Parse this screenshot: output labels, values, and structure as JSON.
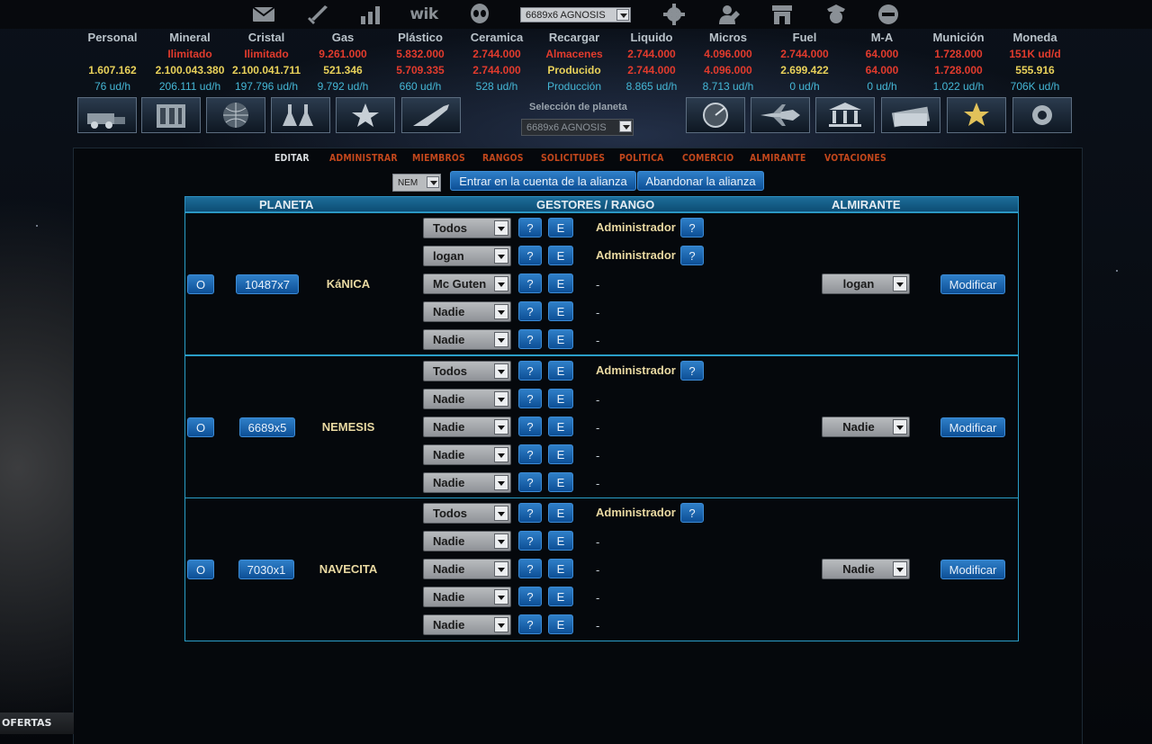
{
  "header": {
    "planet_select": "6689x6 AGNOSIS",
    "planet_select_title": "Selección de planeta",
    "planet_select2": "6689x6 AGNOSIS",
    "wiki_label": "wik"
  },
  "resources": [
    {
      "name": "Personal",
      "line1": "",
      "line2": "1.607.162",
      "line3": "76 ud/h"
    },
    {
      "name": "Mineral",
      "line1": "Ilimitado",
      "line2": "2.100.043.380",
      "line3": "206.111 ud/h"
    },
    {
      "name": "Cristal",
      "line1": "Ilimitado",
      "line2": "2.100.041.711",
      "line3": "197.796 ud/h"
    },
    {
      "name": "Gas",
      "line1": "9.261.000",
      "line2": "521.346",
      "line3": "9.792 ud/h"
    },
    {
      "name": "Plástico",
      "line1": "5.832.000",
      "line2": "5.709.335",
      "line3": "660 ud/h"
    },
    {
      "name": "Ceramica",
      "line1": "2.744.000",
      "line2": "2.744.000",
      "line3": "528 ud/h"
    },
    {
      "name": "Recargar",
      "line1": "Almacenes",
      "line2": "Producido",
      "line3": "Producción"
    },
    {
      "name": "Liquido",
      "line1": "2.744.000",
      "line2": "2.744.000",
      "line3": "8.865 ud/h"
    },
    {
      "name": "Micros",
      "line1": "4.096.000",
      "line2": "4.096.000",
      "line3": "8.713 ud/h"
    },
    {
      "name": "Fuel",
      "line1": "2.744.000",
      "line2": "2.699.422",
      "line3": "0 ud/h"
    },
    {
      "name": "M-A",
      "line1": "64.000",
      "line2": "64.000",
      "line3": "0 ud/h"
    },
    {
      "name": "Munición",
      "line1": "1.728.000",
      "line2": "1.728.000",
      "line3": "1.022 ud/h"
    },
    {
      "name": "Moneda",
      "line1": "151K ud/d",
      "line2": "555.916",
      "line3": "706K ud/h"
    }
  ],
  "tabs": [
    "EDITAR",
    "ADMINISTRAR",
    "MIEMBROS",
    "RANGOS",
    "SOLICITUDES",
    "POLITICA",
    "COMERCIO",
    "ALMIRANTE",
    "VOTACIONES"
  ],
  "actions": {
    "nem_select": "NEM",
    "enter_label": "Entrar en la cuenta de la alianza",
    "leave_label": "Abandonar la alianza"
  },
  "table": {
    "col_planeta": "PLANETA",
    "col_gestores": "GESTORES / RANGO",
    "col_almirante": "ALMIRANTE",
    "o_label": "O",
    "q_label": "?",
    "e_label": "E",
    "modify_label": "Modificar",
    "dash": "-",
    "groups": [
      {
        "coords": "10487x7",
        "name": "KáNICA",
        "admiral": "logan",
        "managers": [
          {
            "who": "Todos",
            "rank": "Administrador"
          },
          {
            "who": "logan",
            "rank": "Administrador"
          },
          {
            "who": "Mc Guten",
            "rank": ""
          },
          {
            "who": "Nadie",
            "rank": ""
          },
          {
            "who": "Nadie",
            "rank": ""
          }
        ]
      },
      {
        "coords": "6689x5",
        "name": "NEMESIS",
        "admiral": "Nadie",
        "managers": [
          {
            "who": "Todos",
            "rank": "Administrador"
          },
          {
            "who": "Nadie",
            "rank": ""
          },
          {
            "who": "Nadie",
            "rank": ""
          },
          {
            "who": "Nadie",
            "rank": ""
          },
          {
            "who": "Nadie",
            "rank": ""
          }
        ]
      },
      {
        "coords": "7030x1",
        "name": "NAVECITA",
        "admiral": "Nadie",
        "managers": [
          {
            "who": "Todos",
            "rank": "Administrador"
          },
          {
            "who": "Nadie",
            "rank": ""
          },
          {
            "who": "Nadie",
            "rank": ""
          },
          {
            "who": "Nadie",
            "rank": ""
          },
          {
            "who": "Nadie",
            "rank": ""
          }
        ]
      }
    ]
  },
  "footer": {
    "ofertas": "OFERTAS"
  }
}
